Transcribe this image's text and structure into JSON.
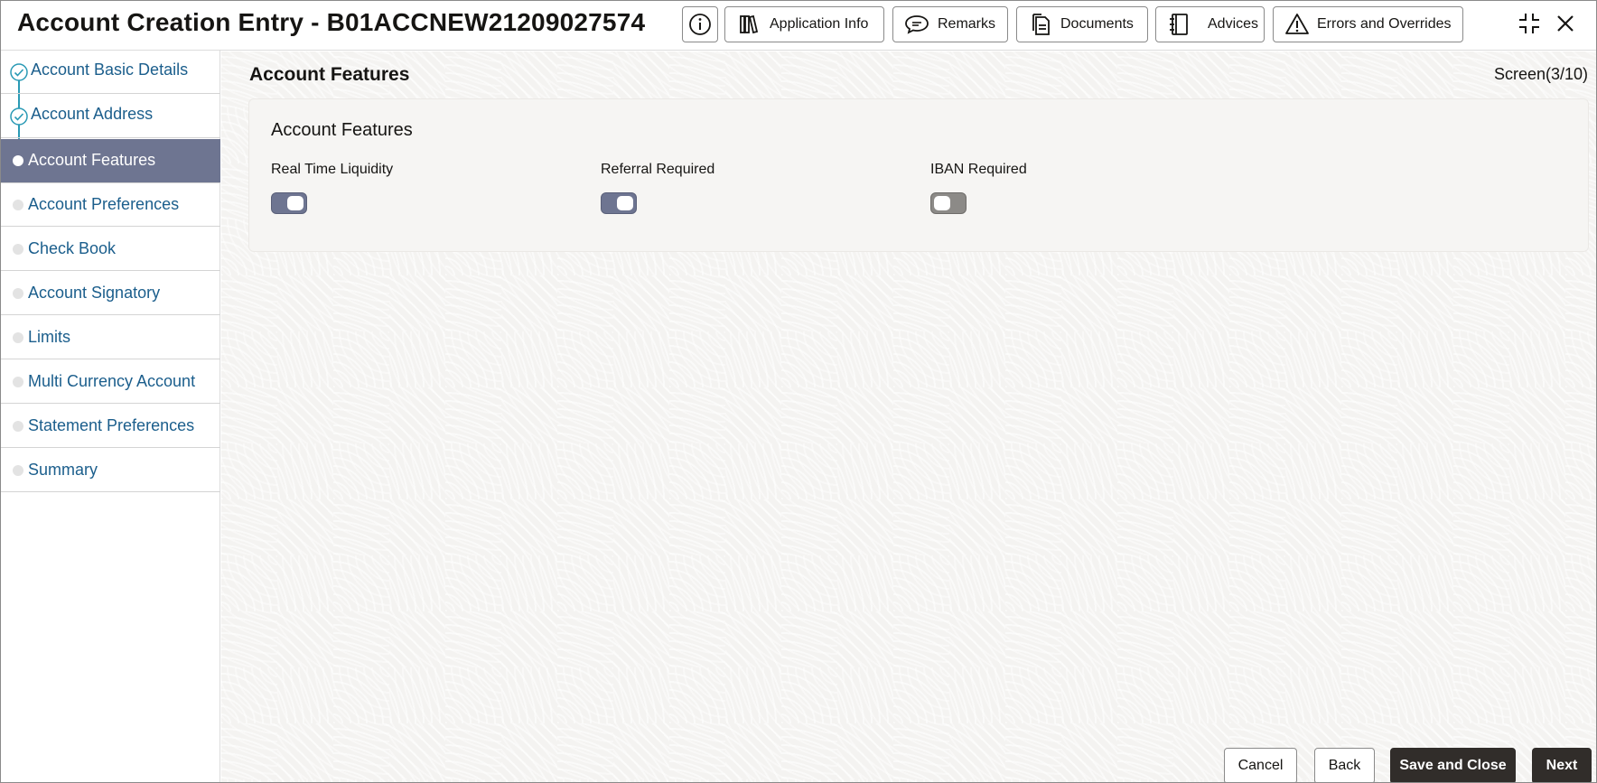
{
  "header": {
    "title": "Account Creation Entry - B01ACCNEW21209027574",
    "buttons": {
      "application_info": "Application Info",
      "remarks": "Remarks",
      "documents": "Documents",
      "advices": "Advices",
      "errors_overrides": "Errors and Overrides"
    },
    "icons": [
      "info-icon",
      "book-icon",
      "chat-icon",
      "documents-icon",
      "notebook-icon",
      "warning-icon",
      "collapse-icon",
      "close-icon"
    ]
  },
  "sidebar": {
    "steps": [
      {
        "label": "Account Basic Details",
        "state": "done"
      },
      {
        "label": "Account Address",
        "state": "done"
      },
      {
        "label": "Account Features",
        "state": "active"
      },
      {
        "label": "Account Preferences",
        "state": "pending"
      },
      {
        "label": "Check Book",
        "state": "pending"
      },
      {
        "label": "Account Signatory",
        "state": "pending"
      },
      {
        "label": "Limits",
        "state": "pending"
      },
      {
        "label": "Multi Currency Account",
        "state": "pending"
      },
      {
        "label": "Statement Preferences",
        "state": "pending"
      },
      {
        "label": "Summary",
        "state": "pending"
      }
    ]
  },
  "main": {
    "section_title": "Account Features",
    "screen_counter": "Screen(3/10)",
    "panel": {
      "title": "Account Features",
      "fields": [
        {
          "label": "Real Time Liquidity",
          "value": true
        },
        {
          "label": "Referral Required",
          "value": true
        },
        {
          "label": "IBAN Required",
          "value": false
        }
      ]
    }
  },
  "footer": {
    "cancel": "Cancel",
    "back": "Back",
    "save_close": "Save and Close",
    "next": "Next"
  },
  "colors": {
    "active_step_bg": "#6e7591",
    "link_text": "#1b5e8c",
    "progress_line": "#2a9ab5",
    "primary_button": "#312d2a",
    "toggle_on": "#6e7591",
    "toggle_off": "#8c8a87"
  }
}
